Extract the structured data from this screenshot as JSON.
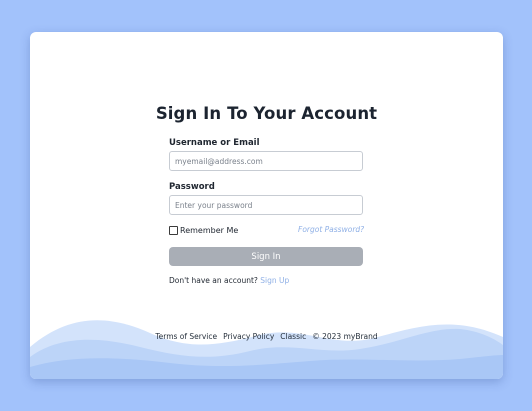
{
  "login": {
    "title": "Sign In To Your Account",
    "username_label": "Username or Email",
    "username_placeholder": "myemail@address.com",
    "password_label": "Password",
    "password_placeholder": "Enter your password",
    "remember_label": "Remember Me",
    "forgot_link": "Forgot Password?",
    "submit_label": "Sign In",
    "signup_prompt": "Don't have an account?",
    "signup_link": "Sign Up"
  },
  "footer": {
    "links": [
      "Terms of Service",
      "Privacy Policy",
      "Classic"
    ],
    "copyright": "© 2023 myBrand"
  },
  "colors": {
    "page_background": "#a2c2fb",
    "card_background": "#ffffff",
    "button_background": "#a9aeb6",
    "link": "#8fb0e6",
    "wave_light": "#d3e3fb",
    "wave_mid": "#bcd4f8",
    "wave_dark": "#a9c7f6"
  }
}
